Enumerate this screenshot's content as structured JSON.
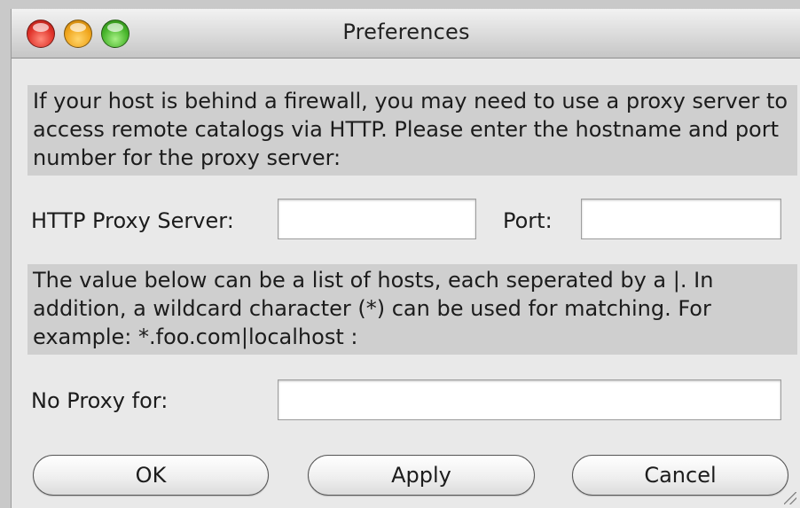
{
  "window": {
    "title": "Preferences",
    "controls": [
      {
        "name": "close",
        "color": "#e0332a"
      },
      {
        "name": "minimize",
        "color": "#f0a51c"
      },
      {
        "name": "zoom",
        "color": "#47b52b"
      }
    ]
  },
  "proxy": {
    "description": "If your host is behind a firewall, you may need to use a proxy server to access remote catalogs via HTTP. Please enter the hostname and port number for the proxy server:",
    "server_label": "HTTP Proxy Server:",
    "server_value": "",
    "port_label": "Port:",
    "port_value": ""
  },
  "no_proxy": {
    "description": "The value below can be a list of hosts, each seperated by a |. In addition, a wildcard character (*) can be used for matching. For example: *.foo.com|localhost :",
    "label": "No Proxy for:",
    "value": ""
  },
  "buttons": {
    "ok": "OK",
    "apply": "Apply",
    "cancel": "Cancel"
  }
}
